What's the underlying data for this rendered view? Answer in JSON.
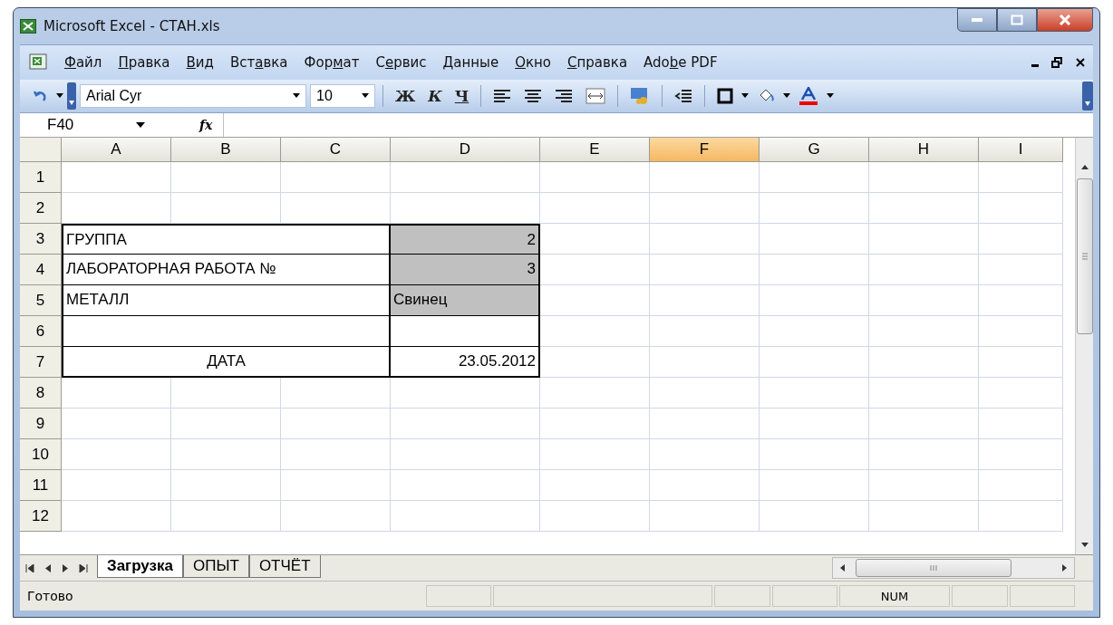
{
  "window": {
    "title": "Microsoft Excel - СТАН.xls"
  },
  "menu": [
    {
      "key": "Ф",
      "after": "айл"
    },
    {
      "key": "П",
      "after": "равка"
    },
    {
      "key": "В",
      "after": "ид"
    },
    {
      "before": "Вст",
      "key": "а",
      "after": "вка"
    },
    {
      "before": "Фор",
      "key": "м",
      "after": "ат"
    },
    {
      "before": "С",
      "key": "е",
      "after": "рвис"
    },
    {
      "key": "Д",
      "after": "анные"
    },
    {
      "key": "О",
      "after": "кно"
    },
    {
      "key": "С",
      "after": "правка"
    },
    {
      "before": "Ado",
      "key": "b",
      "after": "e PDF"
    }
  ],
  "toolbar": {
    "font": "Arial Cyr",
    "size": "10",
    "bold": "Ж",
    "italic": "К",
    "underline": "Ч"
  },
  "formula_bar": {
    "name_box": "F40",
    "fx": "fx"
  },
  "columns": [
    {
      "label": "A",
      "selected": false
    },
    {
      "label": "B",
      "selected": false
    },
    {
      "label": "C",
      "selected": false
    },
    {
      "label": "D",
      "selected": false
    },
    {
      "label": "E",
      "selected": false
    },
    {
      "label": "F",
      "selected": true
    },
    {
      "label": "G",
      "selected": false
    },
    {
      "label": "H",
      "selected": false
    },
    {
      "label": "I",
      "selected": false
    }
  ],
  "rows": [
    {
      "label": "1",
      "kind": "plain"
    },
    {
      "label": "2",
      "kind": "plain"
    },
    {
      "label": "3",
      "kind": "form",
      "title": {
        "text": "ГРУППА",
        "kind": "text"
      },
      "value": {
        "text": "2",
        "kind": "number",
        "shaded": true
      }
    },
    {
      "label": "4",
      "kind": "form",
      "title": {
        "text": "ЛАБОРАТОРНАЯ РАБОТА №",
        "kind": "text"
      },
      "value": {
        "text": "3",
        "kind": "number",
        "shaded": true
      }
    },
    {
      "label": "5",
      "kind": "form",
      "title": {
        "text": "МЕТАЛЛ",
        "kind": "text"
      },
      "value": {
        "text": "Свинец",
        "kind": "text",
        "shaded": true
      }
    },
    {
      "label": "6",
      "kind": "form",
      "value": {
        "shaded": false
      }
    },
    {
      "label": "7",
      "kind": "form",
      "title": {
        "text": "ДАТА",
        "kind": "centered"
      },
      "value": {
        "text": "23.05.2012",
        "kind": "number",
        "shaded": false
      }
    },
    {
      "label": "8",
      "kind": "plain"
    },
    {
      "label": "9",
      "kind": "plain"
    },
    {
      "label": "10",
      "kind": "plain"
    },
    {
      "label": "11",
      "kind": "plain"
    },
    {
      "label": "12",
      "kind": "plain"
    }
  ],
  "sheet_tabs": [
    {
      "label": "Загрузка",
      "selected": true
    },
    {
      "label": "ОПЫТ",
      "selected": false
    },
    {
      "label": "ОТЧЁТ",
      "selected": false
    }
  ],
  "status_bar": {
    "text": "Готово",
    "indicator": "NUM"
  }
}
